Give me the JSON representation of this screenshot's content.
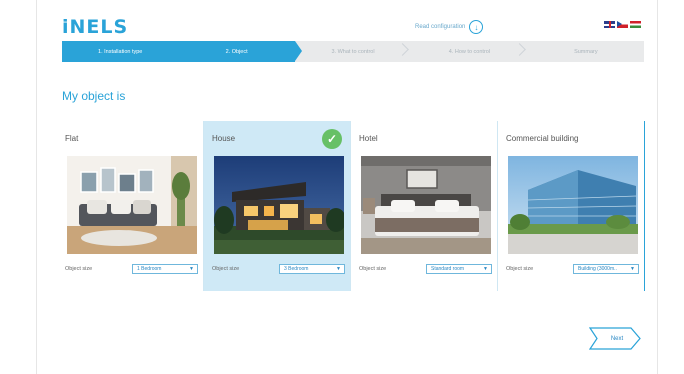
{
  "brand": {
    "logo_text": "iNELS"
  },
  "header": {
    "read_configuration": "Read configuration",
    "languages": [
      "EN",
      "CZ",
      "HU"
    ]
  },
  "steps": [
    {
      "label": "1. Installation type",
      "state": "done"
    },
    {
      "label": "2. Object",
      "state": "current"
    },
    {
      "label": "3. What to control",
      "state": "todo"
    },
    {
      "label": "4. How to control",
      "state": "todo"
    },
    {
      "label": "Summary",
      "state": "todo"
    }
  ],
  "main": {
    "heading": "My object is"
  },
  "cards": [
    {
      "title": "Flat",
      "size_label": "Object size",
      "size_value": "1 Bedroom",
      "selected": false,
      "image": "flat-living-room"
    },
    {
      "title": "House",
      "size_label": "Object size",
      "size_value": "3 Bedroom",
      "selected": true,
      "image": "house-night"
    },
    {
      "title": "Hotel",
      "size_label": "Object size",
      "size_value": "Standard room",
      "selected": false,
      "image": "hotel-room"
    },
    {
      "title": "Commercial building",
      "size_label": "Object size",
      "size_value": "Building (3000m..",
      "selected": false,
      "image": "office-building"
    }
  ],
  "footer": {
    "next_label": "Next"
  },
  "colors": {
    "accent": "#2aa3d8",
    "selected_bg": "#cfe9f6",
    "check": "#67c066"
  }
}
